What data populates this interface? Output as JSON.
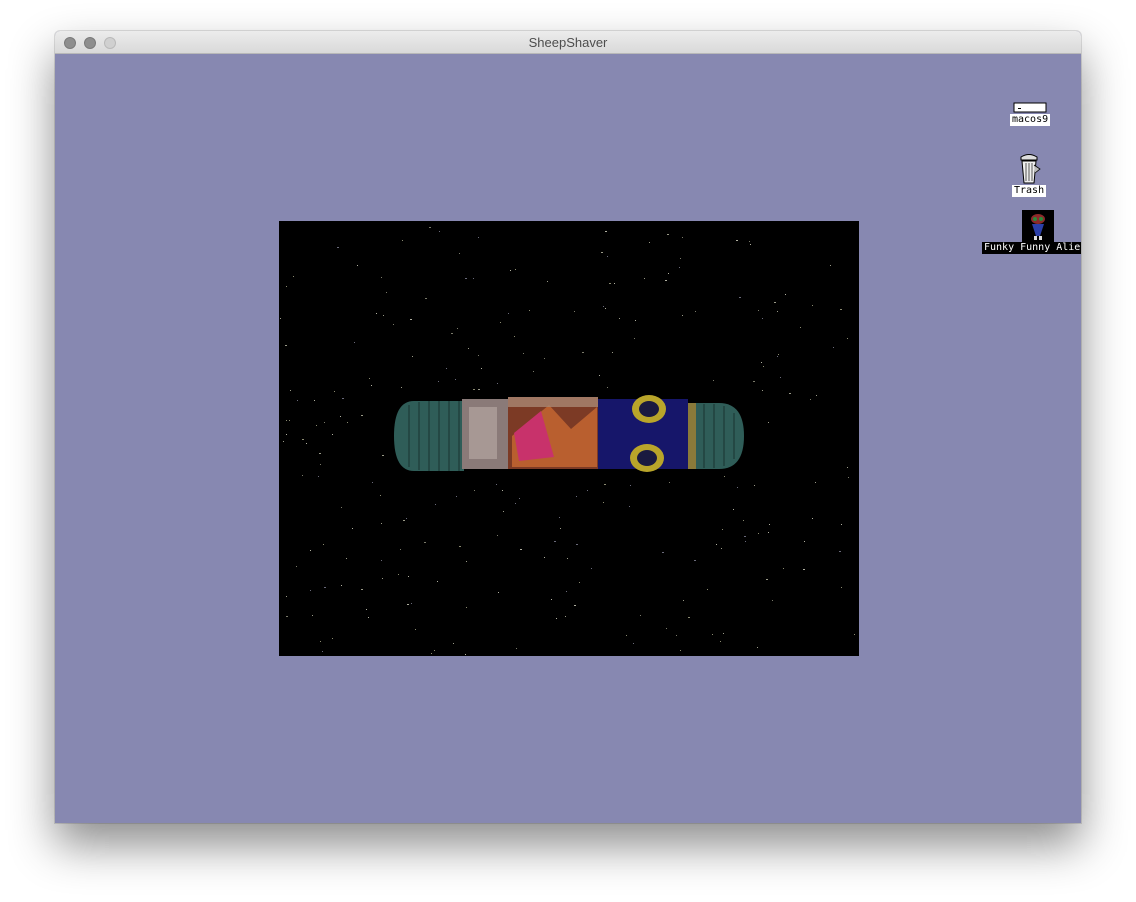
{
  "window": {
    "title": "SheepShaver"
  },
  "desktop": {
    "background_color": "#8788b1",
    "icons": [
      {
        "label": "macos9",
        "icon": "hard-disk-icon",
        "selected": false
      },
      {
        "label": "Trash",
        "icon": "trash-icon",
        "selected": false
      },
      {
        "label": "Funky Funny Aliens",
        "icon": "alien-app-icon",
        "selected": true
      }
    ]
  },
  "game": {
    "scene": "starfield-spaceship",
    "background_color": "#000000"
  }
}
